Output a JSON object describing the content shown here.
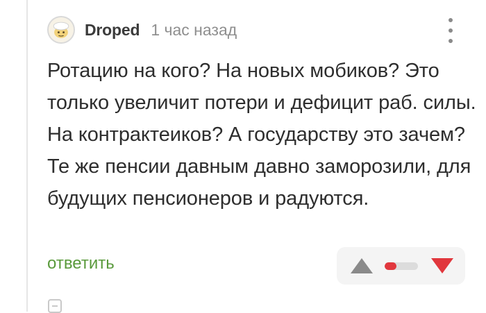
{
  "comment": {
    "author": "Droped",
    "time": "1 час назад",
    "text": "Ротацию на кого? На новых мобиков? Это только увеличит потери и дефицит раб. силы. На контрактеиков? А государству это зачем? Те же пенсии давным давно заморозили, для будущих пенсионеров и радуются.",
    "reply_label": "ответить",
    "rating_fill_fraction": 0.35
  },
  "icons": {
    "avatar": "avatar-image",
    "more": "more-vertical-icon",
    "vote_up": "triangle-up-icon",
    "vote_down": "triangle-down-icon",
    "collapse": "collapse-thread-icon"
  },
  "colors": {
    "reply": "#5a9a3c",
    "vote_up": "#8a8a8a",
    "vote_down": "#e1373d",
    "rating_fill": "#e1373d",
    "rating_track": "#dcdcdc",
    "vote_box_bg": "#f4f4f4"
  }
}
